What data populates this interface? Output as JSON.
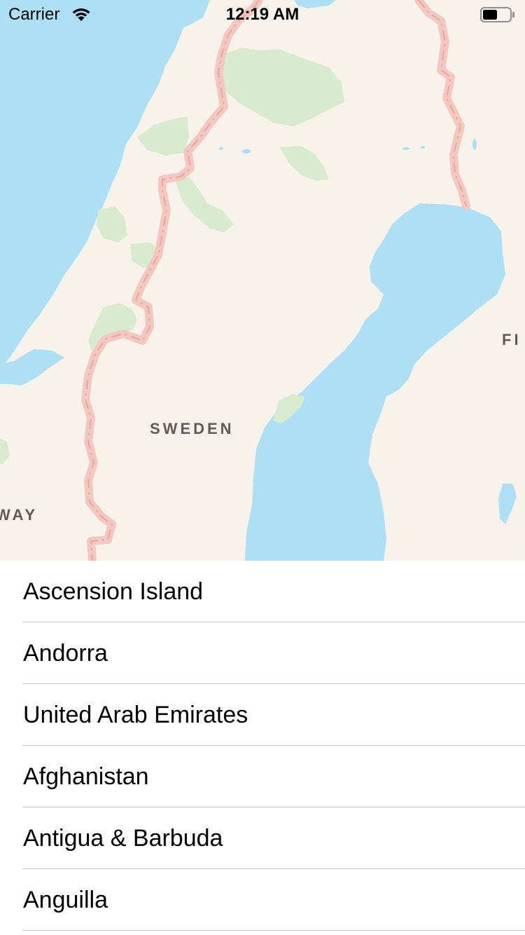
{
  "status_bar": {
    "carrier": "Carrier",
    "time": "12:19 AM",
    "wifi_icon": "wifi-icon",
    "battery_icon": "battery-icon"
  },
  "map": {
    "labels": {
      "sweden": "SWEDEN",
      "norway_partial": "WAY",
      "finland_partial": "FI"
    },
    "colors": {
      "land": "#f8f3ea",
      "water": "#aee0f5",
      "parks": "#d9ebcf",
      "border": "#f2b7ad"
    }
  },
  "list": {
    "items": [
      {
        "label": "Ascension Island"
      },
      {
        "label": "Andorra"
      },
      {
        "label": "United Arab Emirates"
      },
      {
        "label": "Afghanistan"
      },
      {
        "label": "Antigua & Barbuda"
      },
      {
        "label": "Anguilla"
      }
    ]
  }
}
